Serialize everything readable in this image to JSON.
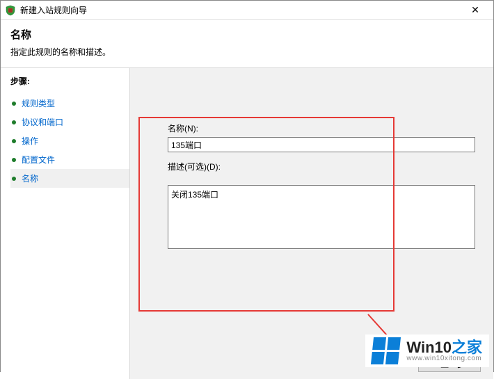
{
  "window": {
    "title": "新建入站规则向导",
    "close_glyph": "✕"
  },
  "header": {
    "title": "名称",
    "subtitle": "指定此规则的名称和描述。"
  },
  "sidebar": {
    "steps_label": "步骤:",
    "items": [
      {
        "label": "规则类型"
      },
      {
        "label": "协议和端口"
      },
      {
        "label": "操作"
      },
      {
        "label": "配置文件"
      },
      {
        "label": "名称"
      }
    ],
    "active_index": 4
  },
  "form": {
    "name_label": "名称(N):",
    "name_value": "135端口",
    "desc_label": "描述(可选)(D):",
    "desc_value": "关闭135端口"
  },
  "buttons": {
    "back": "< 上一步"
  },
  "watermark": {
    "main_a": "Win10",
    "main_b": "之家",
    "sub": "www.win10xitong.com",
    "accent": "#0b7fd8"
  }
}
